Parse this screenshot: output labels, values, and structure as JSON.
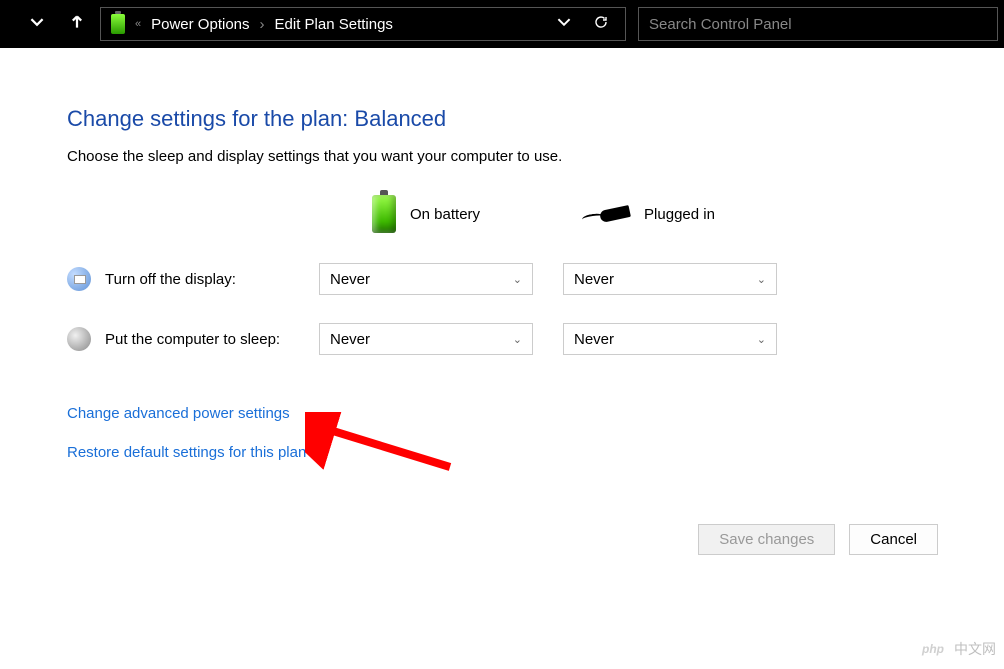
{
  "topbar": {
    "breadcrumb_prefix": "«",
    "crumb1": "Power Options",
    "sep": "›",
    "crumb2": "Edit Plan Settings",
    "search_placeholder": "Search Control Panel"
  },
  "page": {
    "title": "Change settings for the plan: Balanced",
    "description": "Choose the sleep and display settings that you want your computer to use."
  },
  "columns": {
    "battery": "On battery",
    "plugged": "Plugged in"
  },
  "rows": {
    "display": {
      "label": "Turn off the display:",
      "battery_value": "Never",
      "plugged_value": "Never"
    },
    "sleep": {
      "label": "Put the computer to sleep:",
      "battery_value": "Never",
      "plugged_value": "Never"
    }
  },
  "links": {
    "advanced": "Change advanced power settings",
    "restore": "Restore default settings for this plan"
  },
  "buttons": {
    "save": "Save changes",
    "cancel": "Cancel"
  },
  "watermark": {
    "badge": "php",
    "text": "中文网"
  }
}
